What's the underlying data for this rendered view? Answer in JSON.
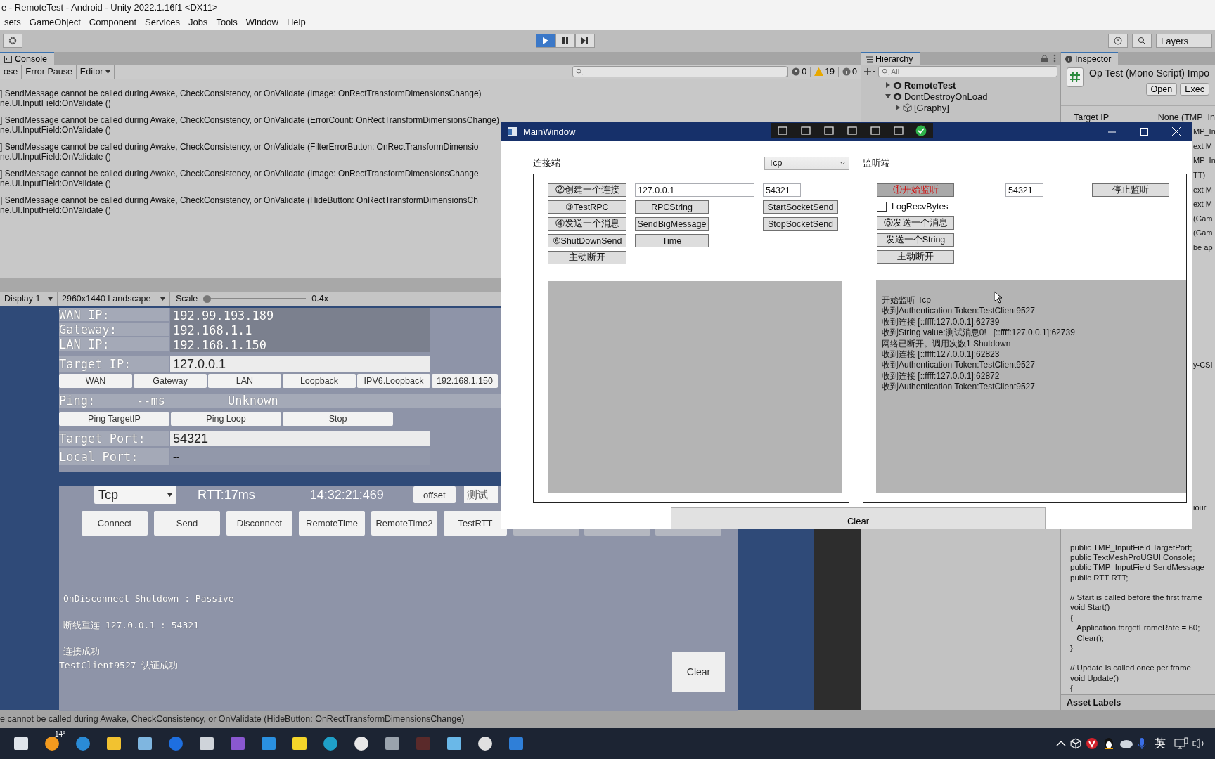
{
  "editor": {
    "title": "e - RemoteTest - Android - Unity 2022.1.16f1 <DX11>",
    "menu": [
      "sets",
      "GameObject",
      "Component",
      "Services",
      "Jobs",
      "Tools",
      "Window",
      "Help"
    ],
    "playing": true,
    "layers": "Layers"
  },
  "console": {
    "tabs": [
      {
        "label": "Console",
        "selected": true
      }
    ],
    "buttons": [
      "ose",
      "Error Pause",
      "Editor"
    ],
    "errors": "0",
    "warnings": "19",
    "logs": "0",
    "messages": [
      {
        "text": "] SendMessage cannot be called during Awake, CheckConsistency, or OnValidate (Image: OnRectTransformDimensionsChange)",
        "detail": "ne.UI.InputField:OnValidate ()"
      },
      {
        "text": "] SendMessage cannot be called during Awake, CheckConsistency, or OnValidate (ErrorCount: OnRectTransformDimensionsChange)",
        "detail": "ne.UI.InputField:OnValidate ()"
      },
      {
        "text": "] SendMessage cannot be called during Awake, CheckConsistency, or OnValidate (FilterErrorButton: OnRectTransformDimensio",
        "detail": "ne.UI.InputField:OnValidate ()"
      },
      {
        "text": "] SendMessage cannot be called during Awake, CheckConsistency, or OnValidate (Image: OnRectTransformDimensionsChange",
        "detail": "ne.UI.InputField:OnValidate ()"
      },
      {
        "text": "] SendMessage cannot be called during Awake, CheckConsistency, or OnValidate (HideButton: OnRectTransformDimensionsCh",
        "detail": "ne.UI.InputField:OnValidate ()"
      }
    ]
  },
  "game": {
    "display": "Display 1",
    "resolution": "2960x1440 Landscape",
    "scale_label": "Scale",
    "scale": {
      "level": 0.0
    },
    "scale_reading": "0.4x",
    "info": [
      {
        "label": "WAN IP:",
        "value": "192.99.193.189"
      },
      {
        "label": "Gateway:",
        "value": "192.168.1.1"
      },
      {
        "label": "LAN IP:",
        "value": "192.168.1.150"
      }
    ],
    "target_ip": {
      "label": "Target IP:",
      "value": "127.0.0.1"
    },
    "ip_buttons": [
      "WAN",
      "Gateway",
      "LAN",
      "Loopback",
      "IPV6.Loopback",
      "192.168.1.150"
    ],
    "ping": {
      "label": "Ping:",
      "ms": "--ms",
      "status": "Unknown"
    },
    "ping_buttons": [
      "Ping TargetIP",
      "Ping Loop",
      "Stop"
    ],
    "target_port": {
      "label": "Target Port:",
      "value": "54321"
    },
    "local_port": {
      "label": "Local Port:",
      "value": "--"
    },
    "protocol": "Tcp",
    "rtt": "RTT:17ms",
    "time": "14:32:21:469",
    "offset": "offset",
    "test_input": "测试",
    "actions": [
      "Connect",
      "Send",
      "Disconnect",
      "RemoteTime",
      "RemoteTime2",
      "TestRTT"
    ],
    "log": [
      "OnDisconnect Shutdown : Passive",
      "断线重连 127.0.0.1 : 54321",
      "连接成功",
      "TestClient9527 认证成功"
    ],
    "clear": "Clear"
  },
  "hierarchy": {
    "title": "Hierarchy",
    "search_placeholder": "All",
    "items": [
      {
        "label": "RemoteTest",
        "expanded": false
      },
      {
        "label": "DontDestroyOnLoad",
        "expanded": true,
        "children": [
          {
            "label": "[Graphy]",
            "expanded": false
          }
        ]
      }
    ]
  },
  "inspector": {
    "title": "Inspector",
    "script": "Op Test (Mono Script) Impo",
    "buttons": [
      "Open",
      "Exec"
    ],
    "field": {
      "label": "Target IP",
      "value": "None (TMP_In"
    },
    "cut_lines": [
      "MP_In",
      "ext M",
      "MP_In",
      "TT)",
      "ext M",
      "ext M",
      "(Gam",
      "(Gam",
      "be ap"
    ],
    "cut_line_2": "y-CSI",
    "cut_line_3": "iour",
    "code_blocks": [
      [
        "public TMP_InputField TargetPort;",
        "public TextMeshProUGUI Console;",
        "public TMP_InputField SendMessage",
        "public RTT RTT;"
      ],
      [
        "// Start is called before the first frame",
        "void Start()",
        "{",
        "   Application.targetFrameRate = 60;",
        "   Clear();",
        "}"
      ],
      [
        "// Update is called once per frame",
        "void Update()",
        "{"
      ]
    ],
    "asset_labels": "Asset Labels"
  },
  "status_bar": "e cannot be called during Awake, CheckConsistency, or OnValidate (HideButton: OnRectTransformDimensionsChange)",
  "main_window": {
    "title": "MainWindow",
    "connector": {
      "title": "连接端",
      "protocol": "Tcp",
      "rows": [
        [
          {
            "kind": "button",
            "label": "②创建一个连接"
          },
          {
            "kind": "input",
            "value": "127.0.0.1"
          },
          {
            "kind": "input",
            "value": "54321"
          }
        ],
        [
          {
            "kind": "button",
            "label": "③TestRPC"
          },
          {
            "kind": "button",
            "label": "RPCString"
          },
          {
            "kind": "button",
            "label": "StartSocketSend"
          }
        ],
        [
          {
            "kind": "button",
            "label": "④发送一个消息"
          },
          {
            "kind": "button",
            "label": "SendBigMessage"
          },
          {
            "kind": "button",
            "label": "StopSocketSend"
          }
        ],
        [
          {
            "kind": "button",
            "label": "⑥ShutDownSend"
          },
          {
            "kind": "button",
            "label": "Time"
          }
        ],
        [
          {
            "kind": "button",
            "label": "主动断开"
          }
        ]
      ]
    },
    "listener": {
      "title": "监听端",
      "start": {
        "label": "①开始监听",
        "active": true
      },
      "port": "54321",
      "stop": "停止监听",
      "log_bytes": {
        "label": "LogRecvBytes",
        "checked": false
      },
      "buttons": [
        "⑤发送一个消息",
        "发送一个String",
        "主动断开"
      ],
      "log": [
        "开始监听 Tcp",
        "收到Authentication Token:TestClient9527",
        "收到连接 [::ffff:127.0.0.1]:62739",
        "收到String value:测试消息0!   [::ffff:127.0.0.1]:62739",
        "网络已断开。调用次数1 Shutdown",
        "收到连接 [::ffff:127.0.0.1]:62823",
        "收到Authentication Token:TestClient9527",
        "收到连接 [::ffff:127.0.0.1]:62872",
        "收到Authentication Token:TestClient9527"
      ]
    },
    "clear": "Clear"
  },
  "taskbar": {
    "weather": "14°",
    "ime": "英"
  }
}
